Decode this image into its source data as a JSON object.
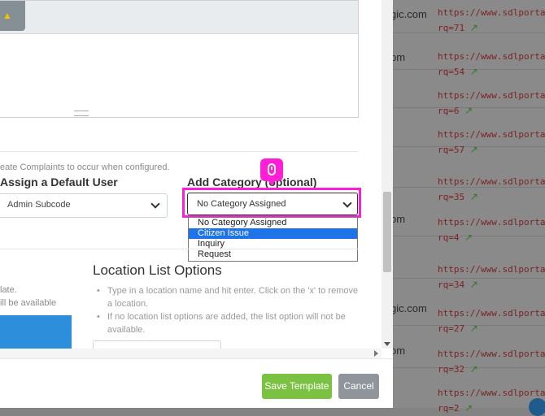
{
  "background_table": {
    "rows": [
      {
        "frag": "gic.com",
        "link1": "https://www.sdlportal",
        "link2": "rq=71"
      },
      {
        "frag": "om",
        "link1": "https://www.sdlportal",
        "link2": "rq=54"
      },
      {
        "frag": "",
        "link1": "https://www.sdlportal",
        "link2": "rq=6"
      },
      {
        "frag": "",
        "link1": "https://www.sdlportal",
        "link2": "rq=57"
      },
      {
        "frag": "",
        "link1": "https://www.sdlportal",
        "link2": "rq=35"
      },
      {
        "frag": "om",
        "link1": "https://www.sdlportal",
        "link2": "rq=4"
      },
      {
        "frag": "",
        "link1": "https://www.sdlportal",
        "link2": "rq=34"
      },
      {
        "frag": "gic.com",
        "link1": "https://www.sdlportal",
        "link2": "rq=27"
      },
      {
        "frag": "om",
        "link1": "https://www.sdlportal",
        "link2": "rq=32"
      },
      {
        "frag": "",
        "link1": "https://www.sdlportal",
        "link2": "rq=2"
      }
    ],
    "external_icon": "external-link-icon"
  },
  "modal": {
    "hint_text": "eate Complaints to occur when configured.",
    "default_user": {
      "label": "Assign a Default User",
      "value": "Admin Subcode"
    },
    "category": {
      "label": "Add Category (optional)",
      "value": "No Category Assigned",
      "options": [
        "No Category Assigned",
        "Citizen Issue",
        "Inquiry",
        "Request"
      ],
      "highlighted_option": "Citizen Issue"
    },
    "left_fragments": {
      "line1": "late.",
      "line2": "ill be available"
    },
    "location": {
      "title": "Location List Options",
      "hints": [
        "Type in a location name and hit enter. Click on the 'x' to remove a location.",
        "If no location list options are added, the list option will not be available."
      ]
    },
    "footer": {
      "save_label": "Save Template",
      "cancel_label": "Cancel"
    }
  },
  "colors": {
    "highlight": "#ff1fd6",
    "save": "#7cc242",
    "cancel": "#8f959b",
    "selected_option": "#1e73e8"
  }
}
